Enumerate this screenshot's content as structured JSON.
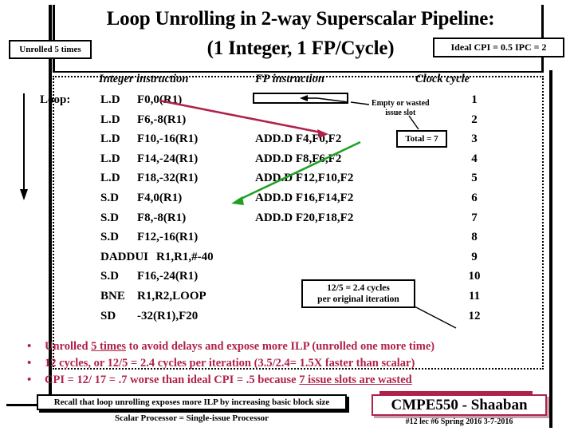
{
  "title": {
    "line1": "Loop Unrolling in 2-way Superscalar Pipeline:",
    "line2": "(1 Integer, 1 FP/Cycle)"
  },
  "badges": {
    "unrolled": "Unrolled 5 times",
    "cpi": "Ideal CPI = 0.5  IPC = 2"
  },
  "table": {
    "headers": {
      "integer": "Integer instruction",
      "fp": "FP instruction",
      "clock": "Clock cycle"
    },
    "loop_label": "Loop:",
    "rows": [
      {
        "op": "L.D",
        "args": "F0,0(R1)",
        "fp": "",
        "clock": "1"
      },
      {
        "op": "L.D",
        "args": "F6,-8(R1)",
        "fp": "",
        "clock": "2"
      },
      {
        "op": "L.D",
        "args": "F10,-16(R1)",
        "fp": "ADD.D F4,F0,F2",
        "clock": "3"
      },
      {
        "op": "L.D",
        "args": "F14,-24(R1)",
        "fp": "ADD.D F8,F6,F2",
        "clock": "4"
      },
      {
        "op": "L.D",
        "args": "F18,-32(R1)",
        "fp": "ADD.D F12,F10,F2",
        "clock": "5"
      },
      {
        "op": "S.D",
        "args": "F4,0(R1)",
        "fp": "ADD.D F16,F14,F2",
        "clock": "6"
      },
      {
        "op": "S.D",
        "args": "F8,-8(R1)",
        "fp": "ADD.D F20,F18,F2",
        "clock": "7"
      },
      {
        "op": "S.D",
        "args": "F12,-16(R1)",
        "fp": "",
        "clock": "8"
      },
      {
        "op": "DADDUI",
        "args": "R1,R1,#-40",
        "fp": "",
        "clock": "9"
      },
      {
        "op": "S.D",
        "args": "F16,-24(R1)",
        "fp": "",
        "clock": "10"
      },
      {
        "op": "BNE",
        "args": "R1,R2,LOOP",
        "fp": "",
        "clock": "11"
      },
      {
        "op": "SD",
        "args": "-32(R1),F20",
        "fp": "",
        "clock": "12"
      }
    ]
  },
  "annotations": {
    "empty_slot_line1": "Empty or wasted",
    "empty_slot_line2": "issue slot",
    "total": "Total = 7",
    "cycles_line1": "12/5 = 2.4 cycles",
    "cycles_line2": "per original iteration"
  },
  "bullets": [
    {
      "dot": "•",
      "text": "Unrolled 5 times to avoid delays and expose more ILP (unrolled one more time)"
    },
    {
      "dot": "•",
      "text": "12 cycles, or 12/5 = 2.4 cycles per iteration (3.5/2.4= 1.5X faster than scalar)"
    },
    {
      "dot": "•",
      "text": "CPI = 12/ 17 = .7  worse than ideal CPI = .5  because 7 issue slots are wasted"
    }
  ],
  "footer": {
    "recall": "Recall that loop unrolling exposes more ILP by increasing basic block size",
    "scalar": "Scalar Processor = Single-issue Processor",
    "course": "CMPE550 - Shaaban",
    "meta": "#12   lec #6  Spring 2016  3-7-2016"
  },
  "colors": {
    "accent_red": "#B0224A",
    "arrow_green": "#1FA024",
    "ink": "#000000"
  }
}
